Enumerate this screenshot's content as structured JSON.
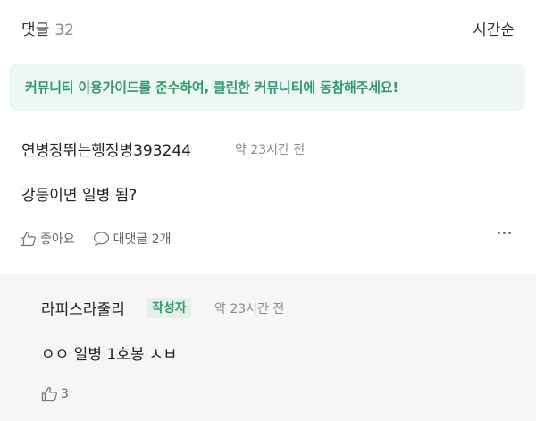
{
  "header": {
    "title": "댓글",
    "count": "32",
    "sort_label": "시간순"
  },
  "notice": {
    "text": "커뮤니티 이용가이드를 준수하여, 클린한 커뮤니티에 동참해주세요!"
  },
  "comment": {
    "author": "연병장뛰는행정병393244",
    "time": "약 23시간 전",
    "body": "강등이면 일병 됨?",
    "like_label": "좋아요",
    "reply_label": "대댓글 2개"
  },
  "reply": {
    "author": "라피스라줄리",
    "badge": "작성자",
    "time": "약 23시간 전",
    "body": "ㅇㅇ 일병 1호봉 ㅅㅂ",
    "like_count": "3"
  },
  "colors": {
    "accent": "#2f9a6c",
    "notice_bg": "#eef7f3",
    "reply_bg": "#f6f6f6"
  },
  "icons": [
    "thumbs-up-icon",
    "speech-bubble-icon",
    "more-icon"
  ]
}
